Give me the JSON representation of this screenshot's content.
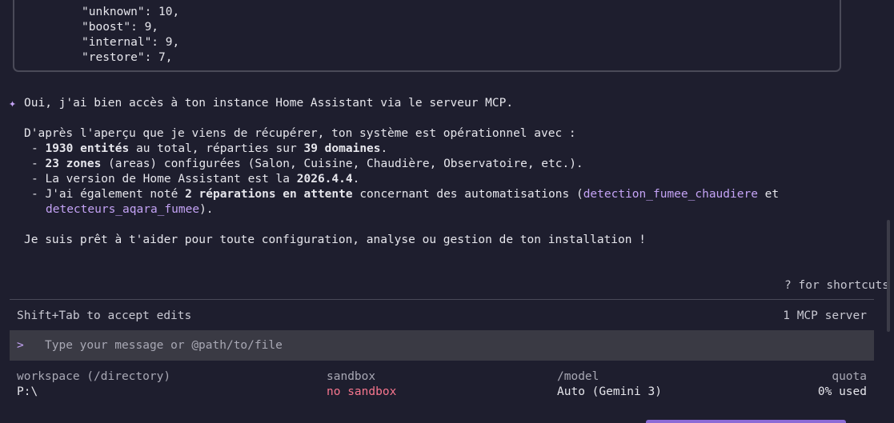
{
  "code_block": {
    "lines": [
      "\"unknown\": 10,",
      "\"boost\": 9,",
      "\"internal\": 9,",
      "\"restore\": 7,"
    ]
  },
  "response": {
    "icon": "sparkle-icon",
    "intro": "Oui, j'ai bien accès à ton instance Home Assistant via le serveur MCP.",
    "overview": "D'après l'aperçu que je viens de récupérer, ton système est opérationnel avec :",
    "bullets": [
      {
        "dash": "-",
        "strong": "1930 entités",
        "text1": " au total, réparties sur ",
        "strong2": "39 domaines",
        "text2": "."
      },
      {
        "dash": "-",
        "strong": "23 zones",
        "text1": " (areas) configurées (Salon, Cuisine, Chaudière, Observatoire, etc.)."
      },
      {
        "dash": "-",
        "text1": "La version de Home Assistant est la ",
        "strong": "2026.4.4",
        "text2": "."
      },
      {
        "dash": "-",
        "text1": "J'ai également noté ",
        "strong": "2 réparations en attente",
        "text2": " concernant des automatisations (",
        "link1": "detection_fumee_chaudiere",
        "text3": " et",
        "link2": "detecteurs_aqara_fumee",
        "text4": ")."
      }
    ],
    "closing": "Je suis prêt à t'aider pour toute configuration, analyse ou gestion de ton installation !"
  },
  "shortcuts_hint": "? for shortcuts",
  "status": {
    "accept_edits": "Shift+Tab to accept edits",
    "mcp_servers": "1 MCP server"
  },
  "input": {
    "prompt_char": ">",
    "placeholder": "Type your message or @path/to/file"
  },
  "footer": {
    "workspace_label": "workspace (/directory)",
    "workspace_value": "P:\\",
    "sandbox_label": "sandbox",
    "sandbox_value": "no sandbox",
    "model_label": "/model",
    "model_value": "Auto (Gemini 3)",
    "quota_label": "quota",
    "quota_value": "0% used"
  },
  "colors": {
    "background": "#1e1e2e",
    "accent": "#c4a3f5",
    "warning": "#f7768e",
    "input_bg": "#3a3a44"
  }
}
